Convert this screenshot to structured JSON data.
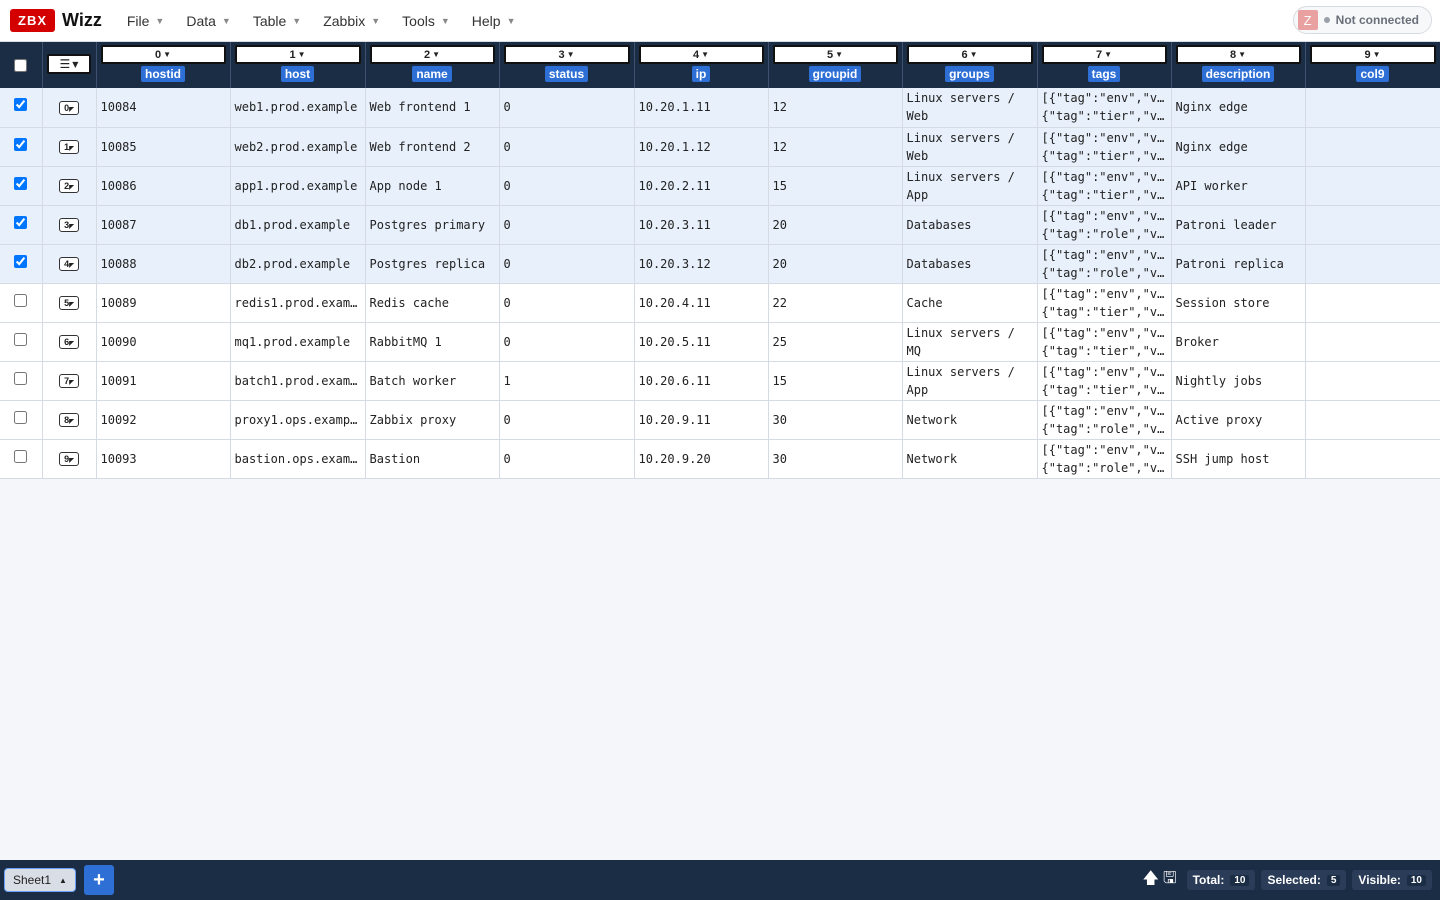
{
  "app": {
    "logo_badge": "ZBX",
    "logo_text": "Wizz"
  },
  "menu": [
    "File",
    "Data",
    "Table",
    "Zabbix",
    "Tools",
    "Help"
  ],
  "connection": {
    "avatar_letter": "Z",
    "status": "Not connected"
  },
  "columns": [
    {
      "index": "0",
      "name": "hostid"
    },
    {
      "index": "1",
      "name": "host"
    },
    {
      "index": "2",
      "name": "name"
    },
    {
      "index": "3",
      "name": "status"
    },
    {
      "index": "4",
      "name": "ip"
    },
    {
      "index": "5",
      "name": "groupid"
    },
    {
      "index": "6",
      "name": "groups"
    },
    {
      "index": "7",
      "name": "tags"
    },
    {
      "index": "8",
      "name": "description"
    },
    {
      "index": "9",
      "name": "col9"
    }
  ],
  "rows": [
    {
      "n": "0",
      "selected": true,
      "cells": [
        "10084",
        "web1.prod.example",
        "Web frontend 1",
        "0",
        "10.20.1.11",
        "12",
        "Linux servers / Web",
        "[{\"tag\":\"env\",\"v…",
        "{\"tag\":\"tier\",\"v…",
        "Nginx edge",
        ""
      ]
    },
    {
      "n": "1",
      "selected": true,
      "cells": [
        "10085",
        "web2.prod.example",
        "Web frontend 2",
        "0",
        "10.20.1.12",
        "12",
        "Linux servers / Web",
        "[{\"tag\":\"env\",\"v…",
        "{\"tag\":\"tier\",\"v…",
        "Nginx edge",
        ""
      ]
    },
    {
      "n": "2",
      "selected": true,
      "cells": [
        "10086",
        "app1.prod.example",
        "App node 1",
        "0",
        "10.20.2.11",
        "15",
        "Linux servers / App",
        "[{\"tag\":\"env\",\"v…",
        "{\"tag\":\"tier\",\"v…",
        "API worker",
        ""
      ]
    },
    {
      "n": "3",
      "selected": true,
      "cells": [
        "10087",
        "db1.prod.example",
        "Postgres primary",
        "0",
        "10.20.3.11",
        "20",
        "Databases",
        "[{\"tag\":\"env\",\"v…",
        "{\"tag\":\"role\",\"v…",
        "Patroni leader",
        ""
      ]
    },
    {
      "n": "4",
      "selected": true,
      "cells": [
        "10088",
        "db2.prod.example",
        "Postgres replica",
        "0",
        "10.20.3.12",
        "20",
        "Databases",
        "[{\"tag\":\"env\",\"v…",
        "{\"tag\":\"role\",\"v…",
        "Patroni replica",
        ""
      ]
    },
    {
      "n": "5",
      "selected": false,
      "cells": [
        "10089",
        "redis1.prod.exam…",
        "Redis cache",
        "0",
        "10.20.4.11",
        "22",
        "Cache",
        "[{\"tag\":\"env\",\"v…",
        "{\"tag\":\"tier\",\"v…",
        "Session store",
        ""
      ]
    },
    {
      "n": "6",
      "selected": false,
      "cells": [
        "10090",
        "mq1.prod.example",
        "RabbitMQ 1",
        "0",
        "10.20.5.11",
        "25",
        "Linux servers / MQ",
        "[{\"tag\":\"env\",\"v…",
        "{\"tag\":\"tier\",\"v…",
        "Broker",
        ""
      ]
    },
    {
      "n": "7",
      "selected": false,
      "cells": [
        "10091",
        "batch1.prod.exam…",
        "Batch worker",
        "1",
        "10.20.6.11",
        "15",
        "Linux servers / App",
        "[{\"tag\":\"env\",\"v…",
        "{\"tag\":\"tier\",\"v…",
        "Nightly jobs",
        ""
      ]
    },
    {
      "n": "8",
      "selected": false,
      "cells": [
        "10092",
        "proxy1.ops.examp…",
        "Zabbix proxy",
        "0",
        "10.20.9.11",
        "30",
        "Network",
        "[{\"tag\":\"env\",\"v…",
        "{\"tag\":\"role\",\"v…",
        "Active proxy",
        ""
      ]
    },
    {
      "n": "9",
      "selected": false,
      "cells": [
        "10093",
        "bastion.ops.exam…",
        "Bastion",
        "0",
        "10.20.9.20",
        "30",
        "Network",
        "[{\"tag\":\"env\",\"v…",
        "{\"tag\":\"role\",\"v…",
        "SSH jump host",
        ""
      ]
    }
  ],
  "footer": {
    "sheet_name": "Sheet1",
    "add_label": "+",
    "total_label": "Total:",
    "total_value": "10",
    "selected_label": "Selected:",
    "selected_value": "5",
    "visible_label": "Visible:",
    "visible_value": "10"
  }
}
